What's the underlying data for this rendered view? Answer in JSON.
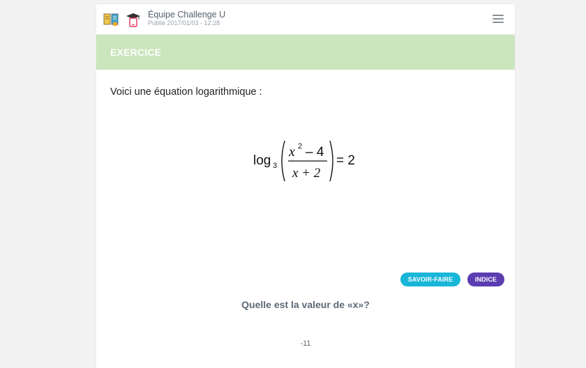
{
  "header": {
    "title": "Équipe Challenge U",
    "subtitle": "Publié 2017/01/03 - 12:28",
    "icons": [
      "book-icon",
      "graduation-cap-phone-icon",
      "hamburger-menu-icon"
    ]
  },
  "banner": {
    "label": "EXERCICE",
    "color": "#cbe5bd"
  },
  "exercise": {
    "intro": "Voici une équation logarithmique :",
    "formula": {
      "log": "log",
      "base": "3",
      "numerator_var": "x",
      "numerator_exp": "2",
      "numerator_rest": "– 4",
      "denominator": "x + 2",
      "rhs": "= 2"
    }
  },
  "badges": {
    "savoir_faire": "SAVOIR-FAIRE",
    "indice": "INDICE",
    "savoir_faire_color": "#1ab6d8",
    "indice_color": "#5b3db1"
  },
  "question": "Quelle est la valeur de «x»?",
  "answer": "-11"
}
